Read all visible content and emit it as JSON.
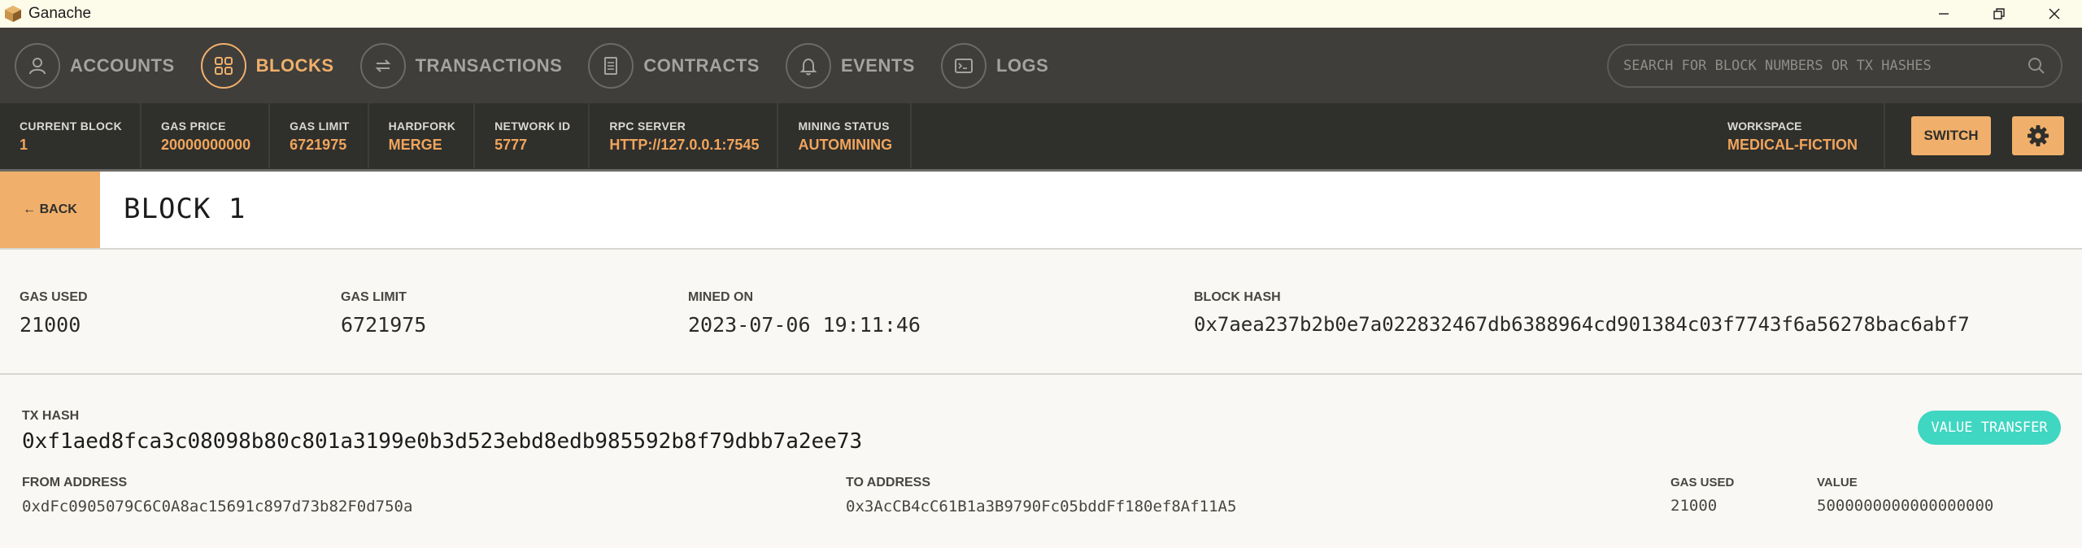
{
  "window": {
    "title": "Ganache",
    "accent": "#f0b06b"
  },
  "nav": {
    "items": [
      {
        "label": "ACCOUNTS",
        "icon": "person-icon",
        "active": false
      },
      {
        "label": "BLOCKS",
        "icon": "grid-icon",
        "active": true
      },
      {
        "label": "TRANSACTIONS",
        "icon": "swap-arrows-icon",
        "active": false
      },
      {
        "label": "CONTRACTS",
        "icon": "document-icon",
        "active": false
      },
      {
        "label": "EVENTS",
        "icon": "bell-icon",
        "active": false
      },
      {
        "label": "LOGS",
        "icon": "terminal-icon",
        "active": false
      }
    ],
    "search_placeholder": "SEARCH FOR BLOCK NUMBERS OR TX HASHES"
  },
  "status": {
    "current_block": {
      "label": "CURRENT BLOCK",
      "value": "1"
    },
    "gas_price": {
      "label": "GAS PRICE",
      "value": "20000000000"
    },
    "gas_limit": {
      "label": "GAS LIMIT",
      "value": "6721975"
    },
    "hardfork": {
      "label": "HARDFORK",
      "value": "MERGE"
    },
    "network_id": {
      "label": "NETWORK ID",
      "value": "5777"
    },
    "rpc_server": {
      "label": "RPC SERVER",
      "value": "HTTP://127.0.0.1:7545"
    },
    "mining_status": {
      "label": "MINING STATUS",
      "value": "AUTOMINING"
    },
    "workspace": {
      "label": "WORKSPACE",
      "value": "MEDICAL-FICTION"
    },
    "switch_label": "SWITCH"
  },
  "block": {
    "back_label": "← BACK",
    "title": "BLOCK 1",
    "gas_used": {
      "label": "GAS USED",
      "value": "21000"
    },
    "gas_limit": {
      "label": "GAS LIMIT",
      "value": "6721975"
    },
    "mined_on": {
      "label": "MINED ON",
      "value": "2023-07-06 19:11:46"
    },
    "block_hash": {
      "label": "BLOCK HASH",
      "value": "0x7aea237b2b0e7a022832467db6388964cd901384c03f7743f6a56278bac6abf7"
    }
  },
  "transaction": {
    "hash_label": "TX HASH",
    "hash": "0xf1aed8fca3c08098b80c801a3199e0b3d523ebd8edb985592b8f79dbb7a2ee73",
    "type_badge": "VALUE TRANSFER",
    "from": {
      "label": "FROM ADDRESS",
      "value": "0xdFc0905079C6C0A8ac15691c897d73b82F0d750a"
    },
    "to": {
      "label": "TO ADDRESS",
      "value": "0x3AcCB4cC61B1a3B9790Fc05bddFf180ef8Af11A5"
    },
    "gas_used": {
      "label": "GAS USED",
      "value": "21000"
    },
    "value": {
      "label": "VALUE",
      "value": "5000000000000000000"
    }
  }
}
